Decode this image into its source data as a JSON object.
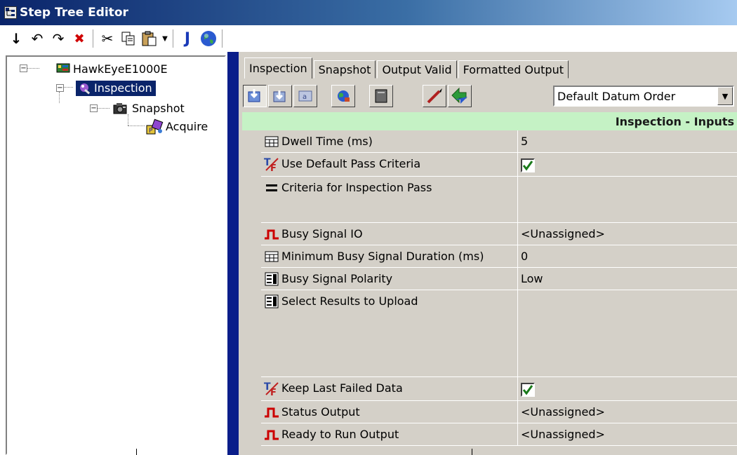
{
  "window": {
    "title": "Step Tree Editor"
  },
  "toolbar": {
    "buttons": [
      {
        "icon": "move-down-icon",
        "label": "↓"
      },
      {
        "icon": "undo-icon",
        "label": "↶"
      },
      {
        "icon": "redo-icon",
        "label": "↷"
      },
      {
        "icon": "delete-icon",
        "label": "✖"
      },
      {
        "icon": "cut-icon",
        "label": "✂"
      },
      {
        "icon": "copy-icon"
      },
      {
        "icon": "paste-icon"
      },
      {
        "icon": "j-script-icon",
        "label": "J"
      },
      {
        "icon": "globe-icon"
      }
    ]
  },
  "tree": {
    "root": "HawkEyeE1000E",
    "inspection": "Inspection",
    "snapshot": "Snapshot",
    "acquire": "Acquire"
  },
  "tabs": [
    "Inspection",
    "Snapshot",
    "Output Valid",
    "Formatted Output"
  ],
  "datum_order": {
    "selected": "Default Datum Order"
  },
  "section_header": "Inspection - Inputs",
  "properties": [
    {
      "name": "Dwell Time (ms)",
      "icon": "numeric-keypad-icon",
      "value": "5"
    },
    {
      "name": "Use Default Pass Criteria",
      "icon": "true-false-icon",
      "value": "",
      "checked": true
    },
    {
      "name": "Criteria for Inspection Pass",
      "icon": "equals-icon",
      "value": ""
    },
    {
      "name": "Busy Signal IO",
      "icon": "pulse-signal-icon",
      "value": "<Unassigned>"
    },
    {
      "name": "Minimum Busy Signal Duration (ms)",
      "icon": "numeric-keypad-icon",
      "value": "0"
    },
    {
      "name": "Busy Signal Polarity",
      "icon": "list-select-icon",
      "value": "Low"
    },
    {
      "name": "Select Results to Upload",
      "icon": "list-select-icon",
      "value": ""
    },
    {
      "name": "Keep Last Failed Data",
      "icon": "true-false-icon",
      "value": "",
      "checked": true
    },
    {
      "name": "Status Output",
      "icon": "pulse-signal-icon",
      "value": "<Unassigned>"
    },
    {
      "name": "Ready to Run Output",
      "icon": "pulse-signal-icon",
      "value": "<Unassigned>"
    }
  ],
  "colors": {
    "selection": "#0a246a",
    "section_header_bg": "#c5f2c5",
    "pulse_icon": "#cc0000",
    "splitter": "#0a1e8a"
  }
}
